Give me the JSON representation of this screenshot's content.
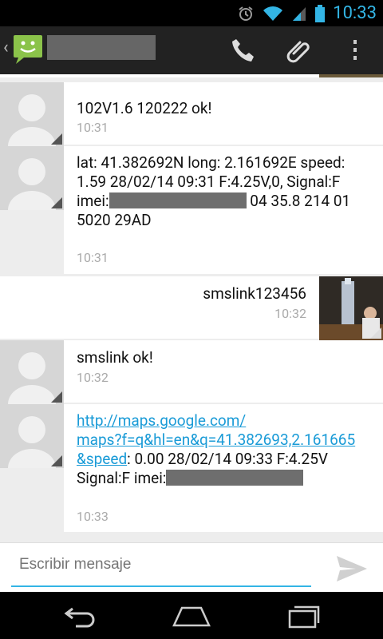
{
  "status_bar": {
    "time": "10:33"
  },
  "action_bar": {
    "contact_name_redacted": true
  },
  "messages": [
    {
      "direction": "in",
      "text": "102V1.6 120222 ok!",
      "time": "10:31"
    },
    {
      "direction": "in",
      "line1": "lat: 41.382692N long: 2.161692E speed:",
      "line2": "1.59 28/02/14 09:31 F:4.25V,0, Signal:F",
      "line3_prefix": "imei:",
      "line3_suffix": " 04 35.8 214 01",
      "line4": "5020 29AD",
      "time": "10:31"
    },
    {
      "direction": "out",
      "text": "smslink123456",
      "time": "10:32"
    },
    {
      "direction": "in",
      "text": "smslink ok!",
      "time": "10:32"
    },
    {
      "direction": "in",
      "link_line1": "http://maps.google.com/",
      "link_line2": "maps?f=q&hl=en&q=41.382693,2.161665",
      "link_line3": "&speed",
      "line3_rest": ": 0.00 28/02/14 09:33 F:4.25V",
      "line4_prefix": "Signal:F imei:",
      "time": "10:33"
    }
  ],
  "compose": {
    "placeholder": "Escribir mensaje"
  }
}
